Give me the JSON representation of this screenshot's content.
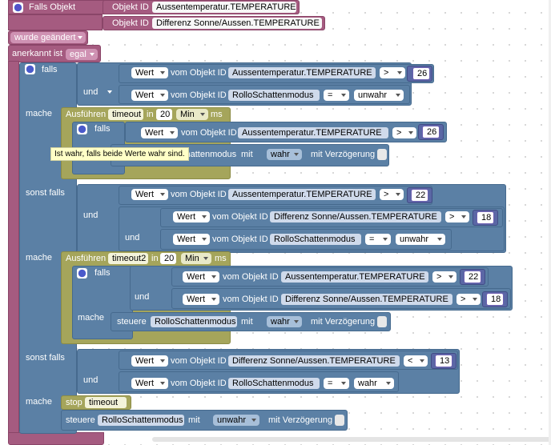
{
  "trigger": {
    "title": "Falls Objekt",
    "obj_label": "Objekt ID",
    "obj1": "Aussentemperatur.TEMPERATURE",
    "obj2": "Differenz Sonne/Aussen.TEMPERATURE",
    "changed": "wurde geändert",
    "ack_label": "anerkannt ist",
    "ack_value": "egal"
  },
  "labels": {
    "falls": "falls",
    "und": "und",
    "mache": "mache",
    "sonst_falls": "sonst falls",
    "wert": "Wert",
    "vom_objekt_id": "vom Objekt ID",
    "ausfuehren": "Ausführen",
    "in": "in",
    "ms": "ms",
    "min": "Min",
    "steuere": "steuere",
    "mit": "mit",
    "mit_verzoegerung": "mit Verzögerung",
    "stop": "stop"
  },
  "objects": {
    "aussen": "Aussentemperatur.TEMPERATURE",
    "rollo": "RolloSchattenmodus",
    "diff": "Differenz Sonne/Aussen.TEMPERATURE",
    "rollo_partial": "chattenmodus"
  },
  "block1": {
    "op1": ">",
    "val1": "26",
    "op2": "=",
    "val2": "unwahr",
    "timer_name": "timeout",
    "timer_in": "20",
    "inner_op": ">",
    "inner_val": "26",
    "set_value": "wahr"
  },
  "block2": {
    "op1": ">",
    "val1": "22",
    "op2": ">",
    "val2": "18",
    "op3": "=",
    "val3": "unwahr",
    "timer_name": "timeout2",
    "timer_in": "20",
    "inner_op1": ">",
    "inner_val1": "22",
    "inner_op2": ">",
    "inner_val2": "18",
    "set_value": "wahr"
  },
  "block3": {
    "op1": "<",
    "val1": "13",
    "op2": "=",
    "val2": "wahr",
    "stop_name": "timeout",
    "set_value": "unwahr"
  },
  "tooltip": "Ist wahr, falls beide Werte wahr sind.",
  "colors": {
    "trigger": "#a55b80",
    "logic": "#5b80a5",
    "timer": "#a5a55b",
    "math": "#5b67a5"
  }
}
